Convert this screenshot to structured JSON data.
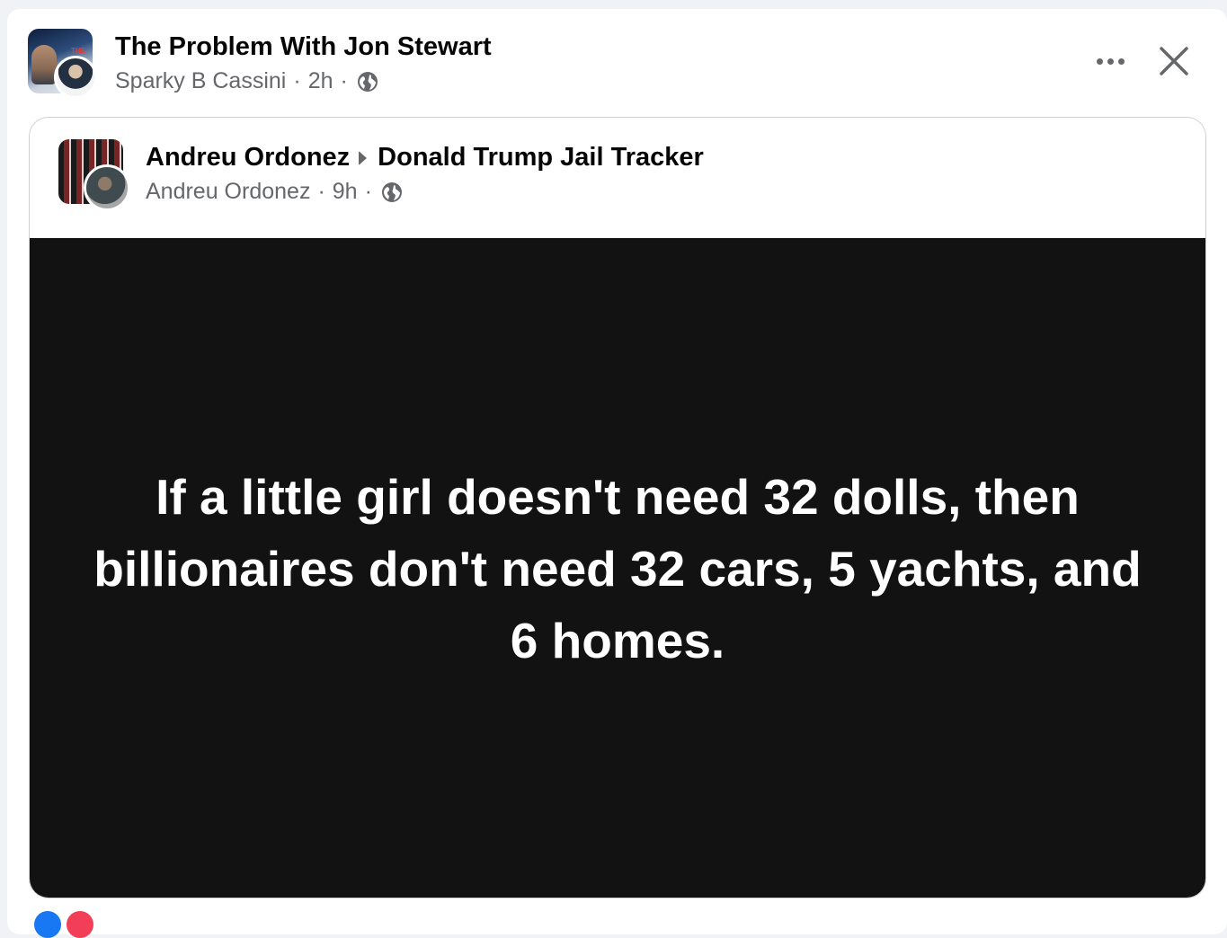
{
  "post": {
    "title": "The Problem With Jon Stewart",
    "author": "Sparky B Cassini",
    "time": "2h",
    "separator": "·",
    "avatar_caption": "THE",
    "privacy_icon": "globe-icon",
    "more_icon": "more-horizontal-icon",
    "close_icon": "close-icon"
  },
  "shared": {
    "author": "Andreu Ordonez",
    "group": "Donald Trump Jail Tracker",
    "meta_author": "Andreu Ordonez",
    "time": "9h",
    "separator": "·",
    "privacy_icon": "globe-icon",
    "quote": "If a little girl doesn't need 32 dolls, then billionaires don't need 32 cars, 5 yachts, and 6 homes."
  },
  "colors": {
    "page_bg": "#f0f2f5",
    "card_bg": "#ffffff",
    "text_primary": "#050505",
    "text_secondary": "#65676b",
    "image_bg": "#121212",
    "like_blue": "#1877f2",
    "love_pink": "#f33e58"
  }
}
